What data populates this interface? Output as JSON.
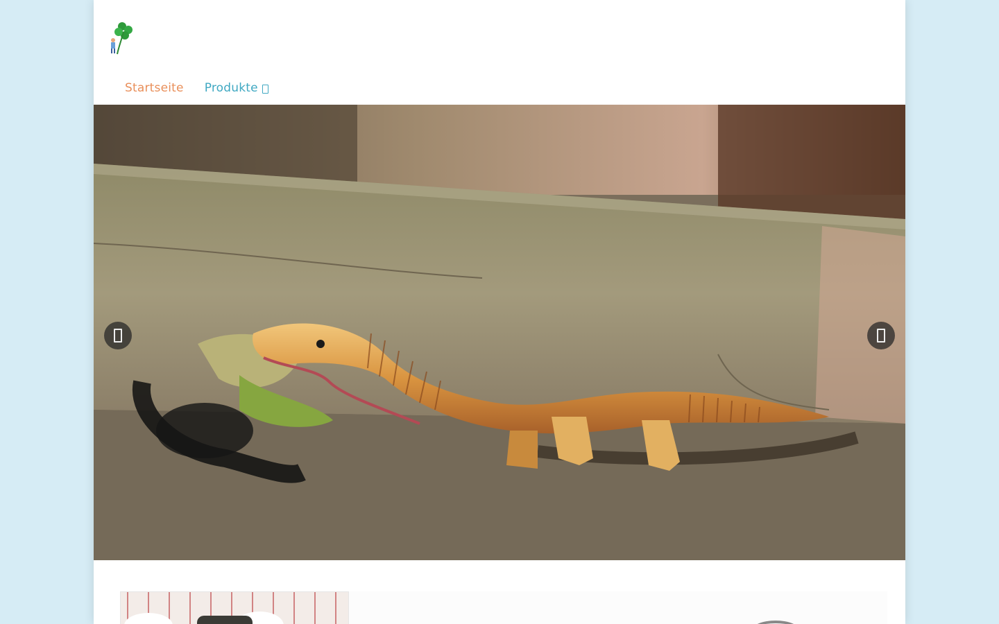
{
  "nav": {
    "home_label": "Startseite",
    "products_label": "Produkte"
  },
  "hero": {
    "prev_icon": "chevron-left-icon",
    "next_icon": "chevron-right-icon"
  },
  "colors": {
    "background": "#d6ecf5",
    "nav_home": "#e98f5a",
    "nav_products": "#3fa8c2"
  }
}
